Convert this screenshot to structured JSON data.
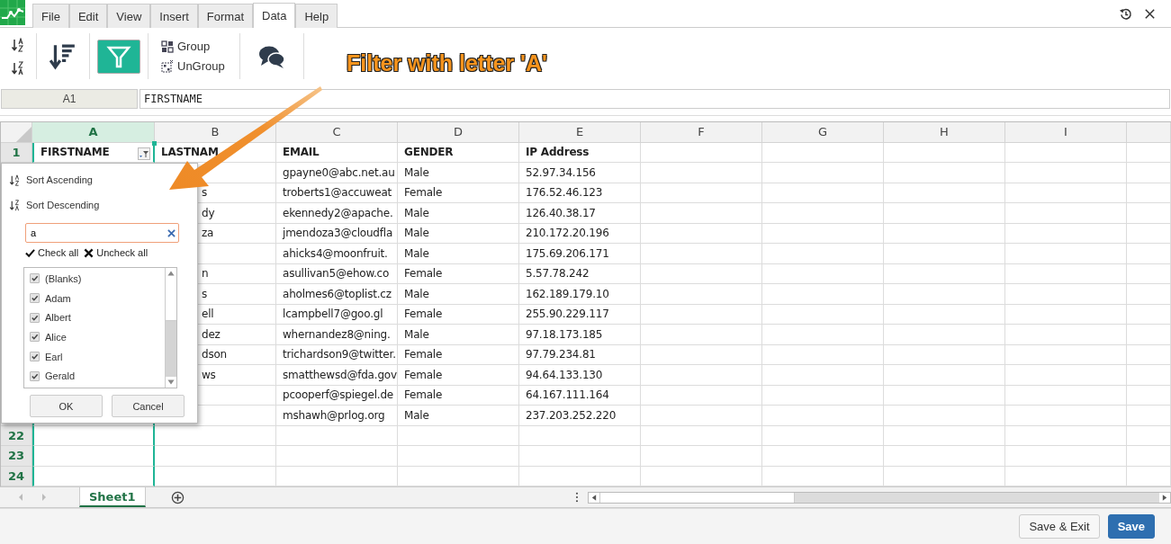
{
  "menu_tabs": [
    {
      "label": "File",
      "selected": false
    },
    {
      "label": "Edit",
      "selected": false
    },
    {
      "label": "View",
      "selected": false
    },
    {
      "label": "Insert",
      "selected": false
    },
    {
      "label": "Format",
      "selected": false
    },
    {
      "label": "Data",
      "selected": true
    },
    {
      "label": "Help",
      "selected": false
    }
  ],
  "toolbar": {
    "filter_on": true,
    "group": "Group",
    "ungroup": "UnGroup"
  },
  "annotation": "Filter with letter 'A'",
  "name_box": "A1",
  "formula": "FIRSTNAME",
  "columns": [
    {
      "label": "A",
      "selected": true
    },
    {
      "label": "B",
      "selected": false
    },
    {
      "label": "C",
      "selected": false
    },
    {
      "label": "D",
      "selected": false
    },
    {
      "label": "E",
      "selected": false
    },
    {
      "label": "F",
      "selected": false
    },
    {
      "label": "G",
      "selected": false
    },
    {
      "label": "H",
      "selected": false
    },
    {
      "label": "I",
      "selected": false
    }
  ],
  "header_row": {
    "number": "1",
    "cells": [
      "FIRSTNAME",
      "LASTNAM",
      "EMAIL",
      "GENDER",
      "IP Address"
    ]
  },
  "data_rows": [
    {
      "lastname": "",
      "email": "gpayne0@abc.net.au",
      "gender": "Male",
      "ip": "52.97.34.156"
    },
    {
      "lastname": "s",
      "email": "troberts1@accuweat",
      "gender": "Female",
      "ip": "176.52.46.123"
    },
    {
      "lastname": "dy",
      "email": "ekennedy2@apache.",
      "gender": "Male",
      "ip": "126.40.38.17"
    },
    {
      "lastname": "za",
      "email": "jmendoza3@cloudfla",
      "gender": "Male",
      "ip": "210.172.20.196"
    },
    {
      "lastname": "",
      "email": "ahicks4@moonfruit.",
      "gender": "Male",
      "ip": "175.69.206.171"
    },
    {
      "lastname": "n",
      "email": "asullivan5@ehow.co",
      "gender": "Female",
      "ip": "5.57.78.242"
    },
    {
      "lastname": "s",
      "email": "aholmes6@toplist.cz",
      "gender": "Male",
      "ip": "162.189.179.10"
    },
    {
      "lastname": "ell",
      "email": "lcampbell7@goo.gl",
      "gender": "Female",
      "ip": "255.90.229.117"
    },
    {
      "lastname": "dez",
      "email": "whernandez8@ning.",
      "gender": "Male",
      "ip": "97.18.173.185"
    },
    {
      "lastname": "dson",
      "email": "trichardson9@twitter.",
      "gender": "Female",
      "ip": "97.79.234.81"
    },
    {
      "lastname": "ws",
      "email": "smatthewsd@fda.gov",
      "gender": "Female",
      "ip": "94.64.133.130"
    },
    {
      "lastname": "",
      "email": "pcooperf@spiegel.de",
      "gender": "Female",
      "ip": "64.167.111.164"
    },
    {
      "lastname": "",
      "email": "mshawh@prlog.org",
      "gender": "Male",
      "ip": "237.203.252.220"
    }
  ],
  "blank_rows": [
    "22",
    "23",
    "24"
  ],
  "filter_popup": {
    "sort_ascending": "Sort Ascending",
    "sort_descending": "Sort Descending",
    "search_value": "a",
    "check_all": "Check all",
    "uncheck_all": "Uncheck all",
    "items": [
      {
        "label": "(Blanks)",
        "checked": true
      },
      {
        "label": "Adam",
        "checked": true
      },
      {
        "label": "Albert",
        "checked": true
      },
      {
        "label": "Alice",
        "checked": true
      },
      {
        "label": "Earl",
        "checked": true
      },
      {
        "label": "Gerald",
        "checked": true
      }
    ],
    "ok": "OK",
    "cancel": "Cancel"
  },
  "sheet_tabs": [
    {
      "label": "Sheet1",
      "selected": true
    }
  ],
  "buttons": {
    "save_exit": "Save & Exit",
    "save": "Save"
  }
}
